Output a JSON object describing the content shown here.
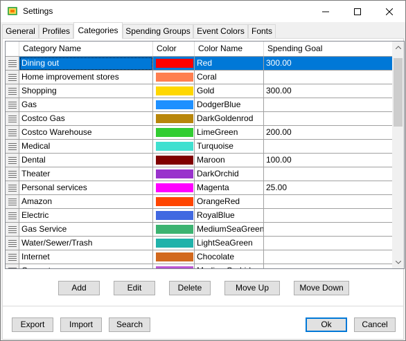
{
  "window": {
    "title": "Settings"
  },
  "tabs": [
    "General",
    "Profiles",
    "Categories",
    "Spending Groups",
    "Event Colors",
    "Fonts"
  ],
  "active_tab": "Categories",
  "columns": [
    "Category Name",
    "Color",
    "Color Name",
    "Spending Goal"
  ],
  "rows": [
    {
      "name": "Dining out",
      "color": "#ff0000",
      "color_name": "Red",
      "goal": "300.00",
      "selected": true
    },
    {
      "name": "Home improvement stores",
      "color": "#ff7f50",
      "color_name": "Coral",
      "goal": ""
    },
    {
      "name": "Shopping",
      "color": "#ffd700",
      "color_name": "Gold",
      "goal": "300.00"
    },
    {
      "name": "Gas",
      "color": "#1e90ff",
      "color_name": "DodgerBlue",
      "goal": ""
    },
    {
      "name": "Costco Gas",
      "color": "#b8860b",
      "color_name": "DarkGoldenrod",
      "goal": ""
    },
    {
      "name": "Costco Warehouse",
      "color": "#32cd32",
      "color_name": "LimeGreen",
      "goal": "200.00"
    },
    {
      "name": "Medical",
      "color": "#40e0d0",
      "color_name": "Turquoise",
      "goal": ""
    },
    {
      "name": "Dental",
      "color": "#800000",
      "color_name": "Maroon",
      "goal": "100.00"
    },
    {
      "name": "Theater",
      "color": "#9932cc",
      "color_name": "DarkOrchid",
      "goal": ""
    },
    {
      "name": "Personal services",
      "color": "#ff00ff",
      "color_name": "Magenta",
      "goal": "25.00"
    },
    {
      "name": "Amazon",
      "color": "#ff4500",
      "color_name": "OrangeRed",
      "goal": ""
    },
    {
      "name": "Electric",
      "color": "#4169e1",
      "color_name": "RoyalBlue",
      "goal": ""
    },
    {
      "name": "Gas Service",
      "color": "#3cb371",
      "color_name": "MediumSeaGreen",
      "goal": ""
    },
    {
      "name": "Water/Sewer/Trash",
      "color": "#20b2aa",
      "color_name": "LightSeaGreen",
      "goal": ""
    },
    {
      "name": "Internet",
      "color": "#d2691e",
      "color_name": "Chocolate",
      "goal": ""
    },
    {
      "name": "Computer",
      "color": "#ba55d3",
      "color_name": "MediumOrchid",
      "goal": ""
    }
  ],
  "grid_buttons": {
    "add": "Add",
    "edit": "Edit",
    "delete": "Delete",
    "move_up": "Move Up",
    "move_down": "Move Down"
  },
  "bottom_buttons": {
    "export": "Export",
    "import": "Import",
    "search": "Search",
    "ok": "Ok",
    "cancel": "Cancel"
  }
}
